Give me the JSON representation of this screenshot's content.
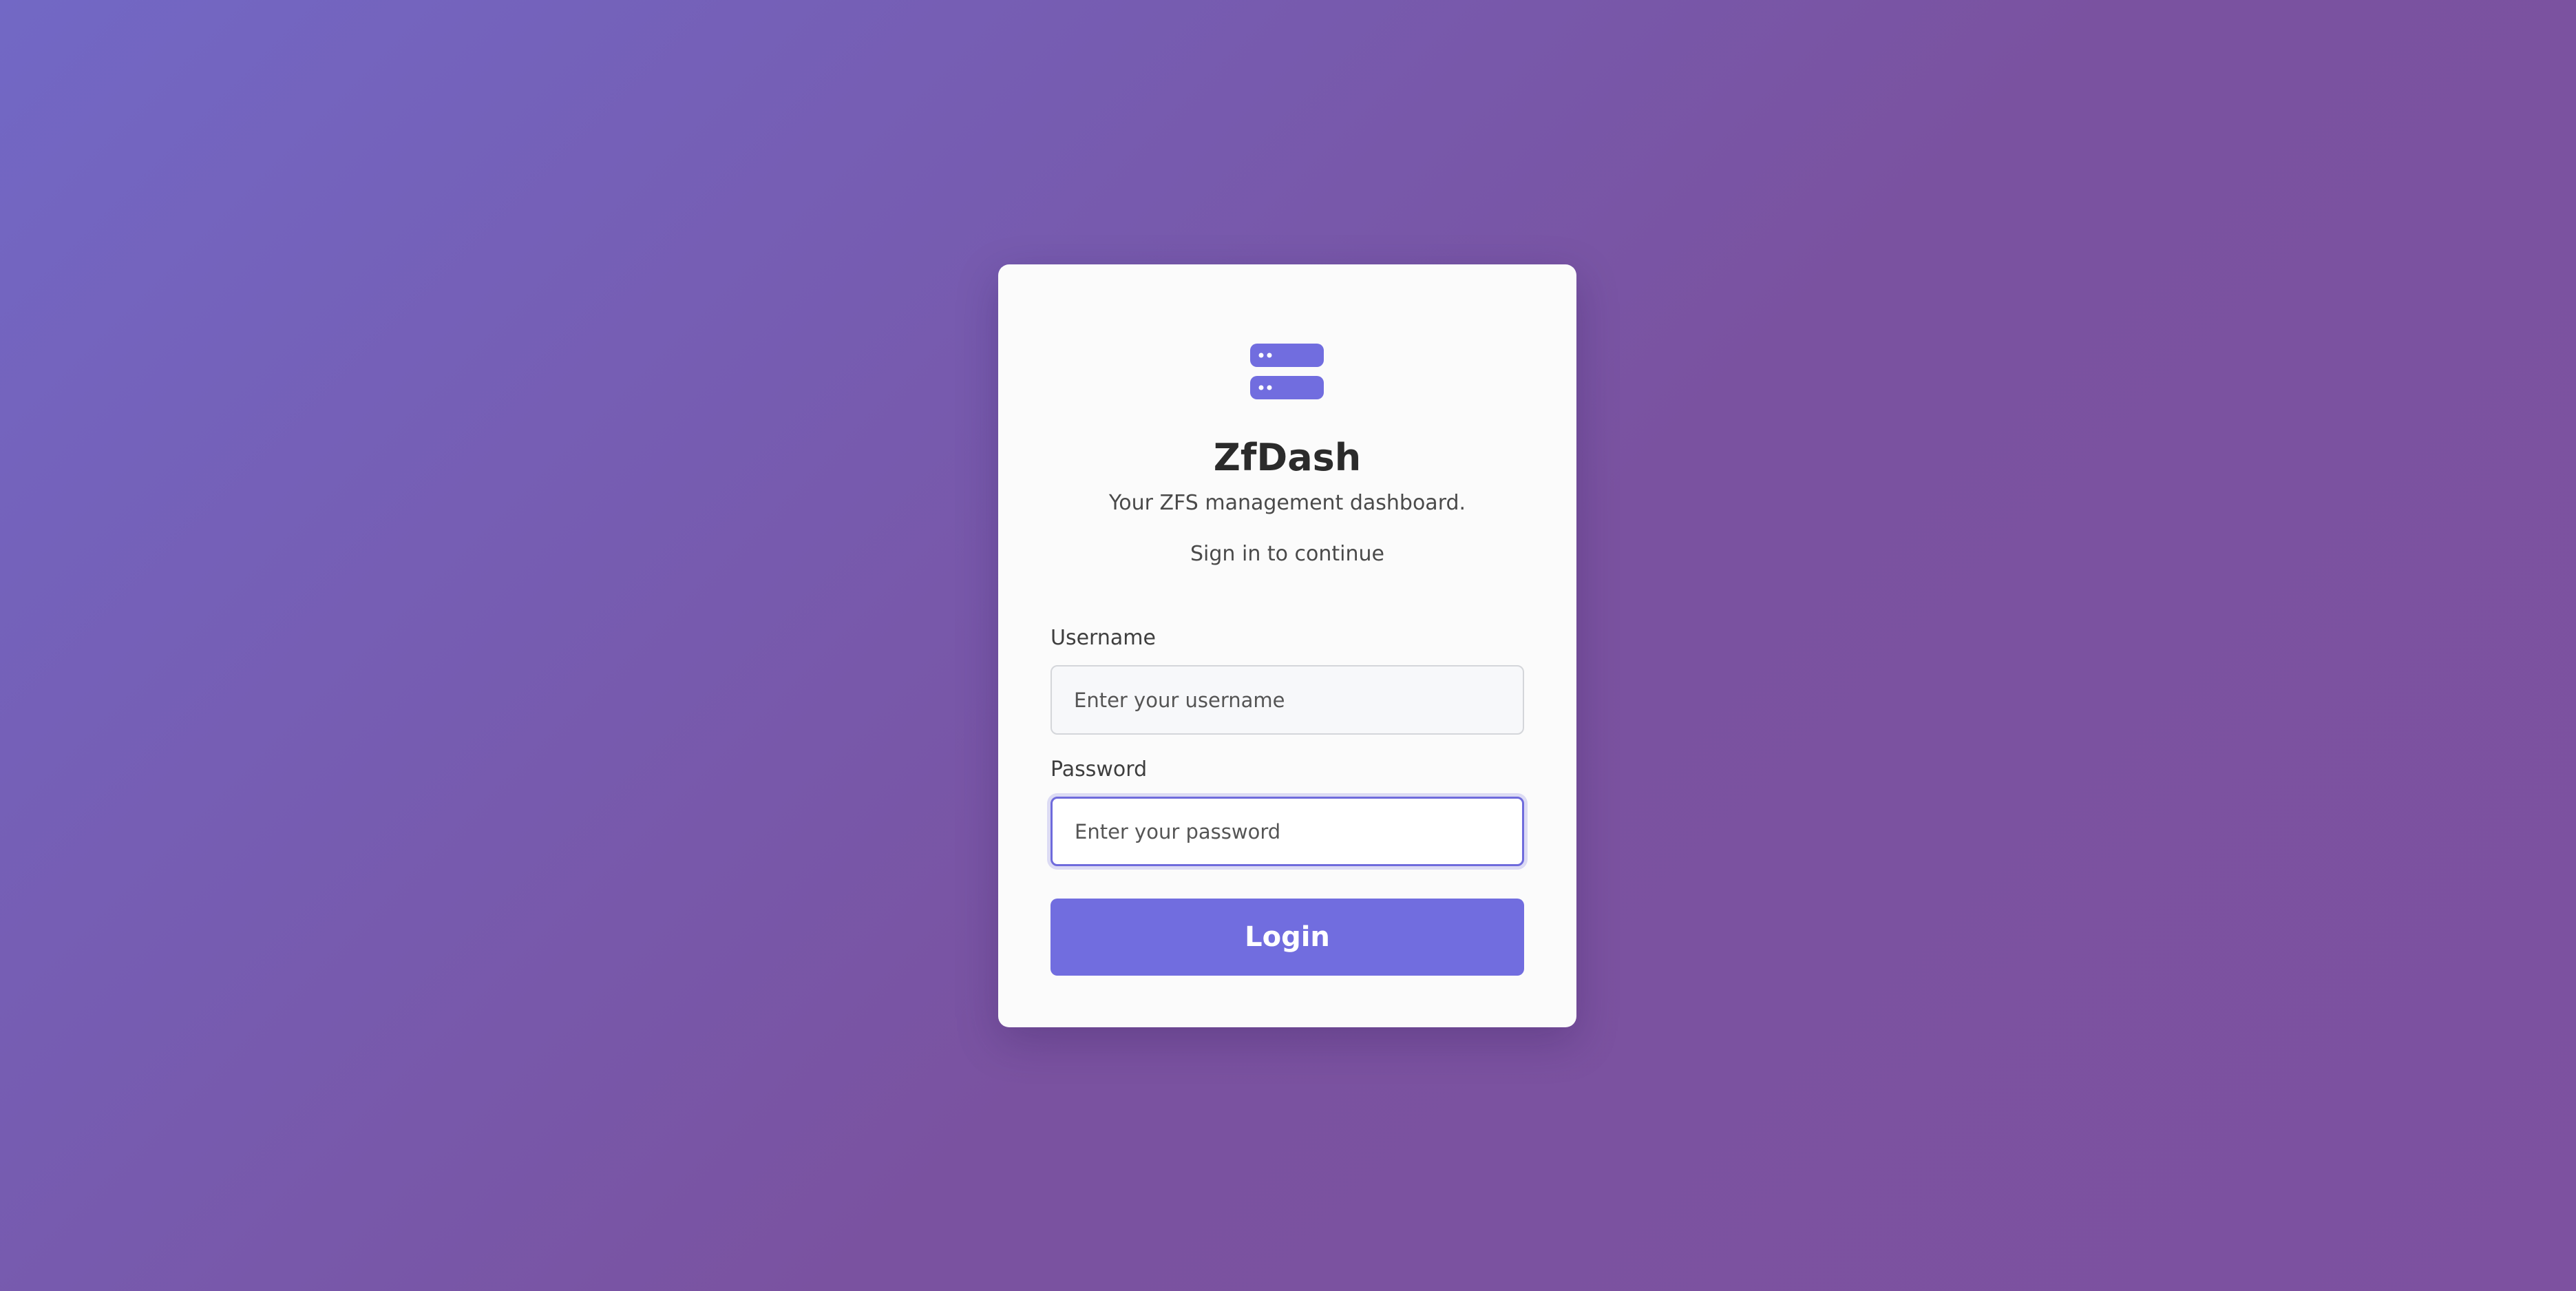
{
  "app": {
    "name": "ZfDash",
    "tagline": "Your ZFS management dashboard.",
    "prompt": "Sign in to continue"
  },
  "form": {
    "username": {
      "label": "Username",
      "placeholder": "Enter your username",
      "value": ""
    },
    "password": {
      "label": "Password",
      "placeholder": "Enter your password",
      "value": ""
    },
    "submit_label": "Login"
  },
  "icons": {
    "logo": "server-icon"
  },
  "colors": {
    "accent": "#716ddf",
    "background_start": "#7268c5",
    "background_end": "#7d51a0",
    "card": "#fbfbfb"
  }
}
